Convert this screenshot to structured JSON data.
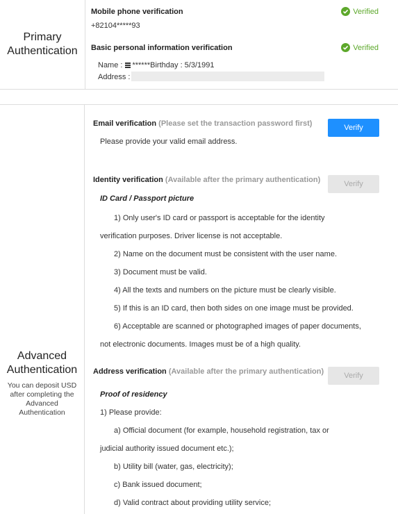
{
  "primary": {
    "title_line1": "Primary",
    "title_line2": "Authentication",
    "mobile_title": "Mobile phone verification",
    "mobile_status": "Verified",
    "mobile_number": "+82104*****93",
    "basic_title": "Basic personal information verification",
    "basic_status": "Verified",
    "name_label": "Name :",
    "name_masked": "******",
    "birthday_text": "Birthday : 5/3/1991",
    "address_label": "Address :"
  },
  "advanced": {
    "title_line1": "Advanced",
    "title_line2": "Authentication",
    "subtitle": "You can deposit USD after completing the Advanced Authentication",
    "email": {
      "title": "Email verification",
      "note": "(Please set the transaction password first)",
      "button": "Verify",
      "desc": "Please provide your valid email address."
    },
    "identity": {
      "title": "Identity verification",
      "note": "(Available after the primary authentication)",
      "button": "Verify",
      "subtitle": "ID Card / Passport picture",
      "items": [
        "1) Only user's ID card or passport is acceptable for the identity",
        "verification purposes. Driver license is not acceptable.",
        "2) Name on the document must be consistent with the user name.",
        "3) Document must be valid.",
        "4) All the texts and numbers on the picture must be clearly visible.",
        "5) If this is an ID card, then both sides on one image must be provided.",
        "6) Acceptable are scanned or photographed images of paper documents,",
        "not electronic documents. Images must be of a high quality."
      ]
    },
    "address": {
      "title": "Address verification",
      "note": "(Available after the primary authentication)",
      "button": "Verify",
      "subtitle": "Proof of residency",
      "items": [
        "1) Please provide:",
        "a) Official document (for example, household registration, tax or",
        "judicial authority issued document etc.);",
        "b) Utility bill (water, gas, electricity);",
        "c) Bank issued document;",
        "d) Valid contract about providing utility service;"
      ]
    }
  },
  "colors": {
    "verified": "#5da82b",
    "primary_button": "#1e90ff",
    "disabled_button": "#e6e6e6"
  },
  "icons": {
    "verified": "check-circle-icon",
    "name_flag": "flag-icon"
  }
}
